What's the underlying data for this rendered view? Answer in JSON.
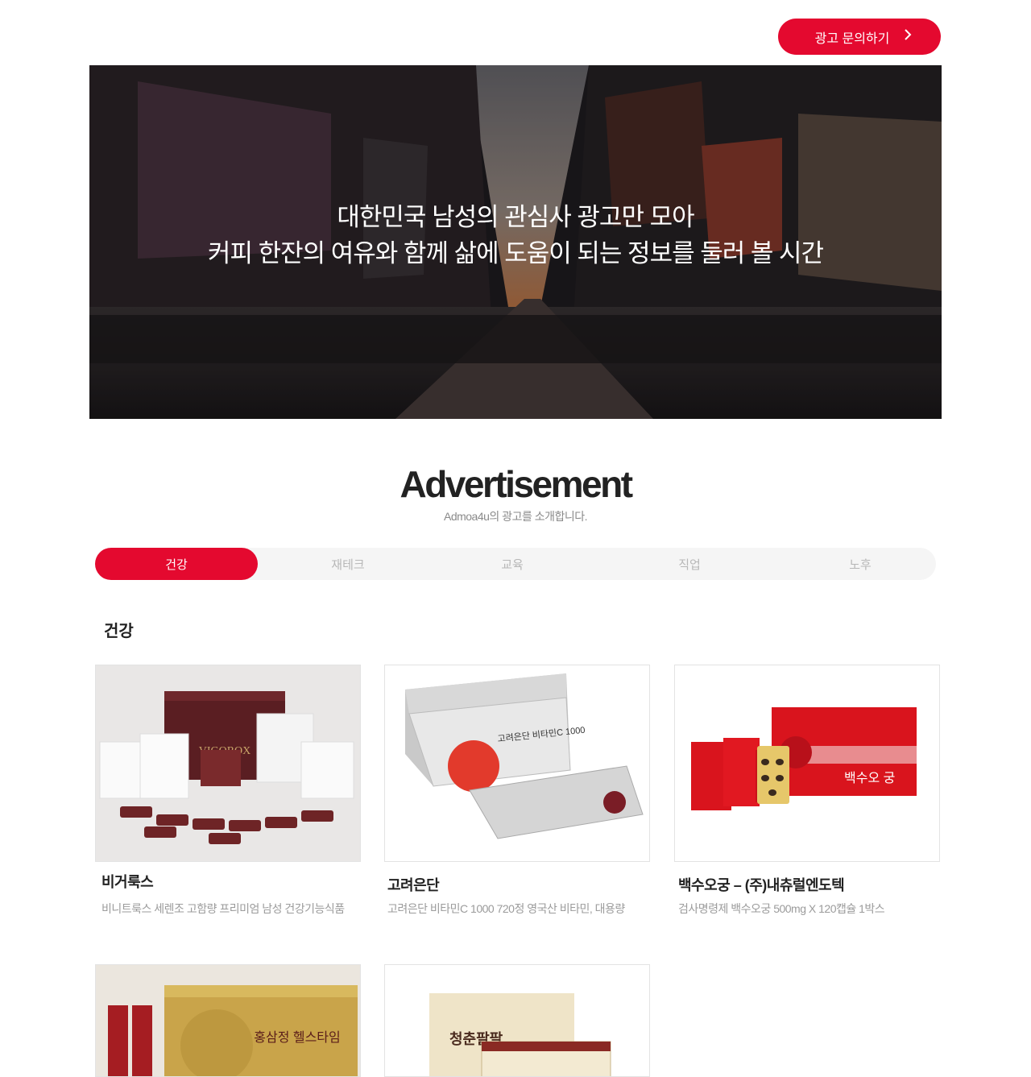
{
  "header": {
    "cta_label": "광고 문의하기",
    "cta_icon": "chevron-right-icon"
  },
  "hero": {
    "line1": "대한민국 남성의 관심사 광고만 모아",
    "line2": "커피 한잔의 여유와 함께 삶에 도움이 되는 정보를 둘러 볼 시간"
  },
  "section": {
    "title": "Advertisement",
    "subtitle": "Admoa4u의 광고를 소개합니다."
  },
  "tabs": [
    {
      "label": "건강",
      "active": true
    },
    {
      "label": "재테크",
      "active": false
    },
    {
      "label": "교육",
      "active": false
    },
    {
      "label": "직업",
      "active": false
    },
    {
      "label": "노후",
      "active": false
    }
  ],
  "category_heading": "건강",
  "products": [
    {
      "title": "비거룩스",
      "desc": "비니트룩스 세렌조 고함량 프리미엄 남성 건강기능식품"
    },
    {
      "title": "고려은단",
      "desc": "고려은단 비타민C 1000 720정 영국산 비타민, 대용량"
    },
    {
      "title": "백수오궁 – (주)내츄럴엔도텍",
      "desc": "검사명령제 백수오궁 500mg X 120캡슐 1박스"
    },
    {
      "title": "",
      "desc": ""
    },
    {
      "title": "",
      "desc": ""
    }
  ],
  "product_image_text": {
    "vigorox": "VIGOROX",
    "vitamin": "고려은단 비타민C 1000",
    "baeksuo": "백수오 궁",
    "hongsam": "홍삼정 헬스타임",
    "chungchun": "청춘팔팔"
  },
  "colors": {
    "accent": "#e4092f",
    "tab_bg": "#f5f5f5"
  }
}
